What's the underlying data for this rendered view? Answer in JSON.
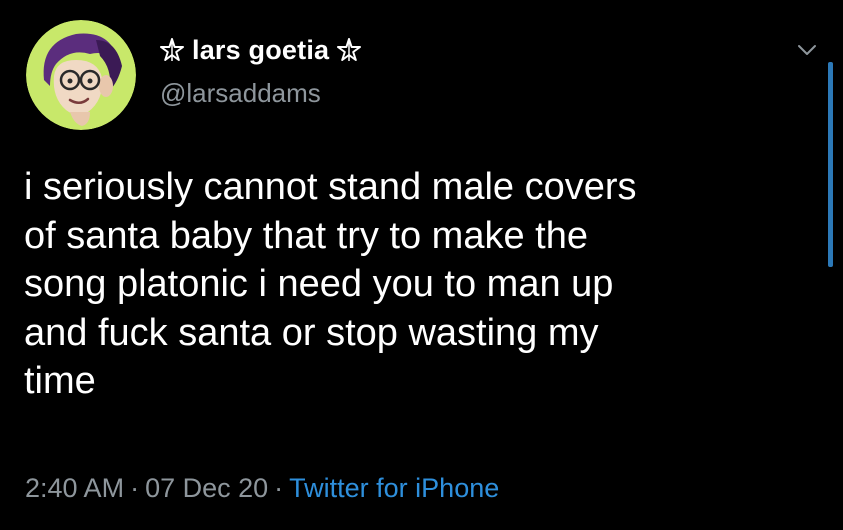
{
  "tweet": {
    "display_name": "lars goetia",
    "handle": "@larsaddams",
    "text": "i seriously cannot stand male covers\nof santa baby that try to make the\nsong platonic i need you to man up\nand fuck santa or stop wasting my\ntime",
    "time": "2:40 AM",
    "date": "07 Dec 20",
    "separator": "·",
    "source": "Twitter for iPhone"
  },
  "icons": {
    "name_prefix": "pentagram-icon",
    "name_suffix": "pentagram-icon",
    "menu": "chevron-down-icon",
    "avatar": "avatar"
  },
  "colors": {
    "background": "#000000",
    "text": "#ffffff",
    "secondary": "#8e969c",
    "link": "#2e8fdc",
    "avatar_bg": "#c8e86a",
    "scrollbar": "#2c79b8"
  }
}
